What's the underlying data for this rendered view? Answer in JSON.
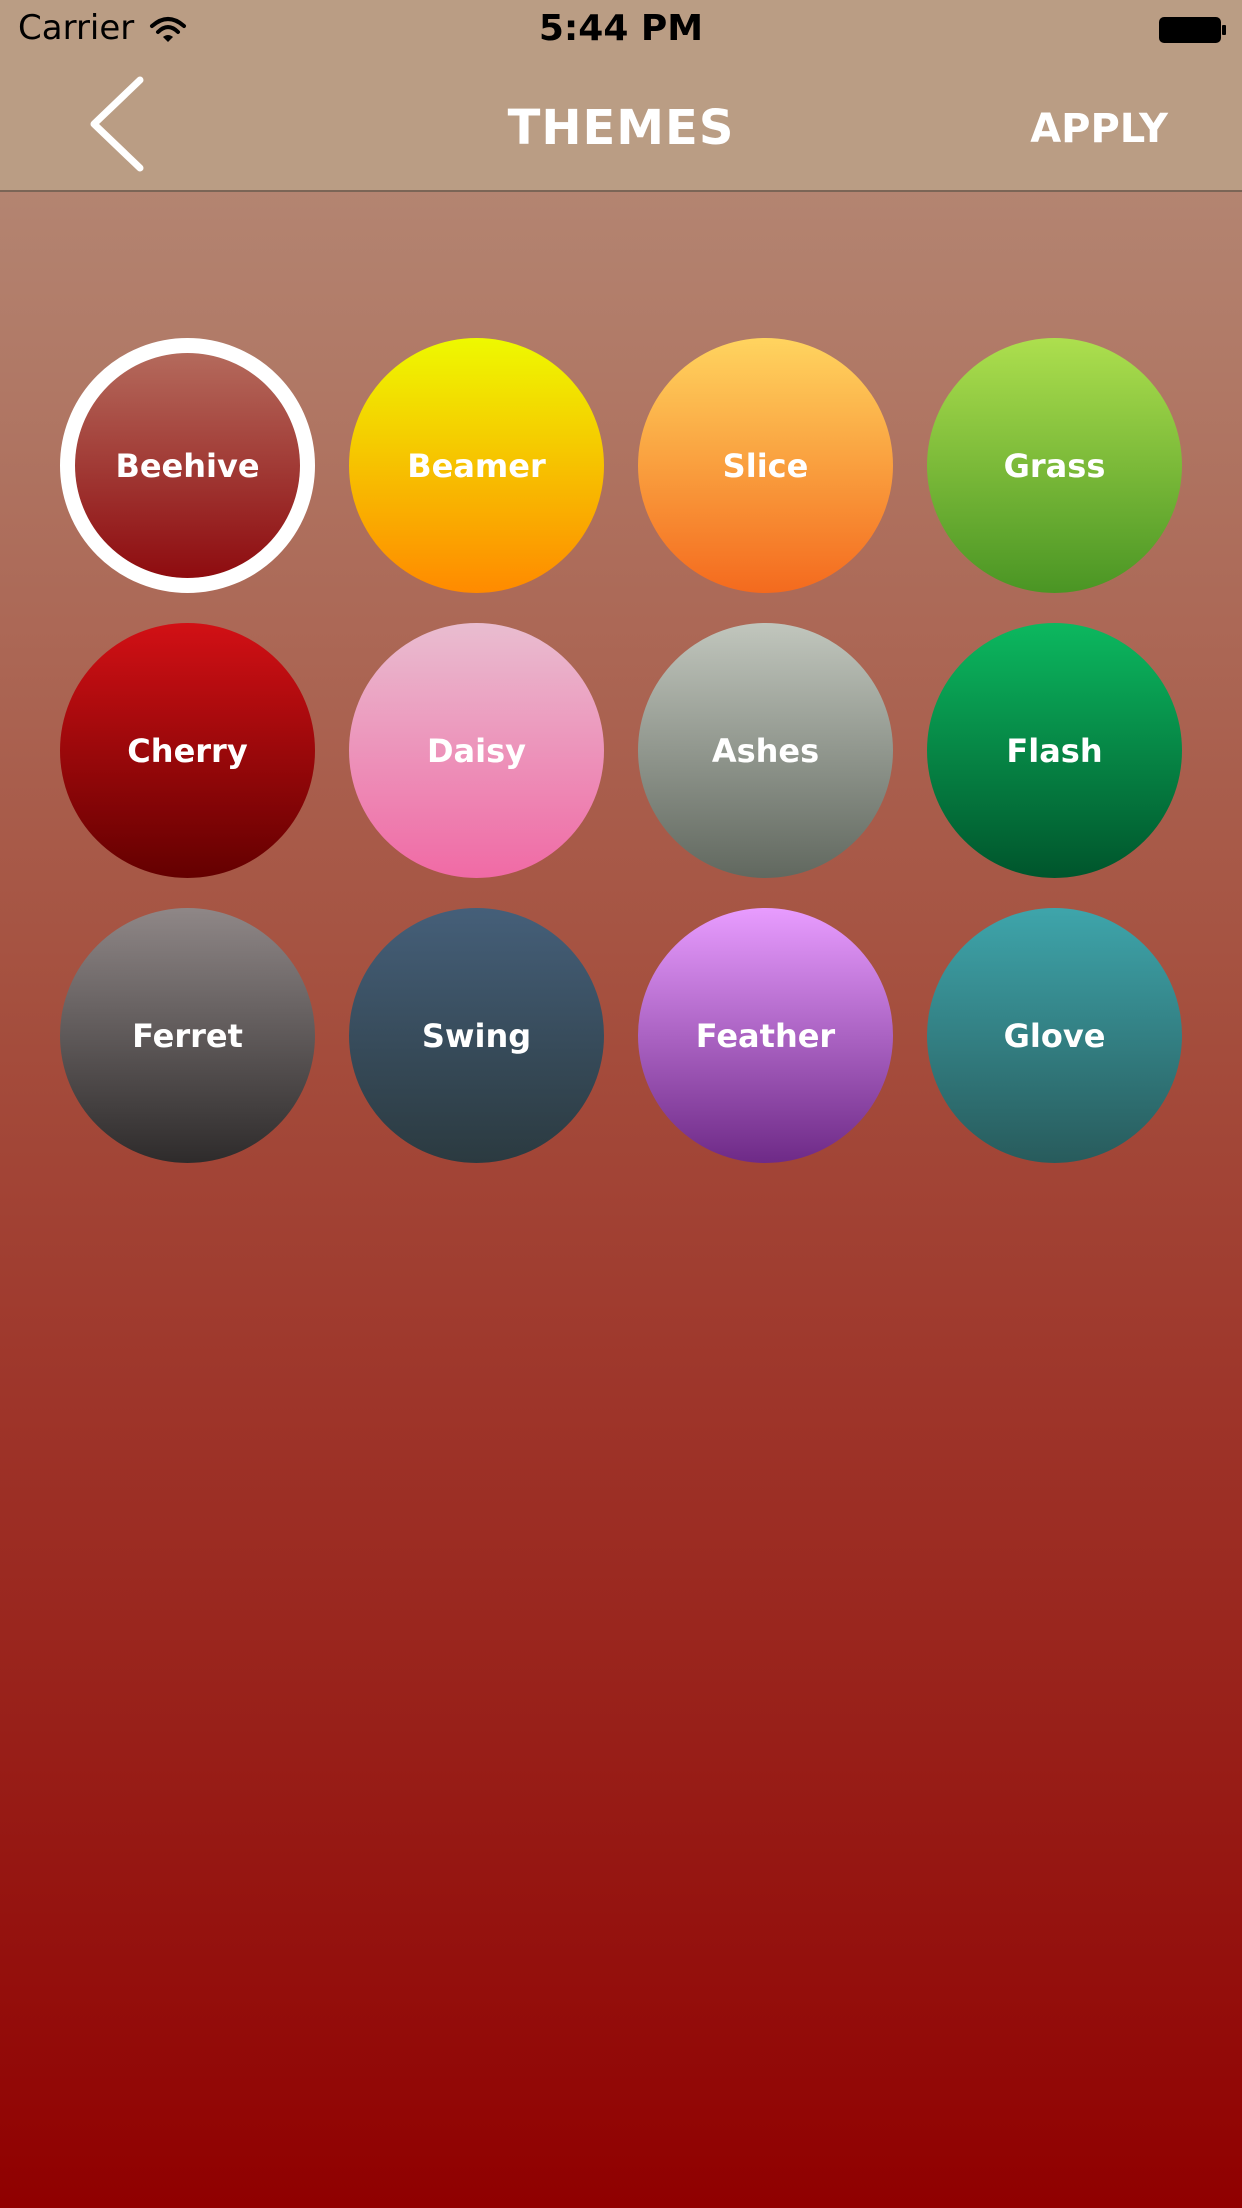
{
  "status_bar": {
    "carrier": "Carrier",
    "time": "5:44 PM",
    "icons": [
      "wifi-icon",
      "battery-icon"
    ]
  },
  "nav": {
    "back_icon": "chevron-left-icon",
    "title": "THEMES",
    "apply_label": "APPLY"
  },
  "themes": [
    {
      "name": "Beehive",
      "selected": true,
      "colors": [
        "#b46a5c",
        "#8e0b0f"
      ]
    },
    {
      "name": "Beamer",
      "selected": false,
      "colors": [
        "#eef900",
        "#ff8a00"
      ]
    },
    {
      "name": "Slice",
      "selected": false,
      "colors": [
        "#ffd45f",
        "#f46a1e"
      ]
    },
    {
      "name": "Grass",
      "selected": false,
      "colors": [
        "#addf4e",
        "#4a9524"
      ]
    },
    {
      "name": "Cherry",
      "selected": false,
      "colors": [
        "#d21015",
        "#640000"
      ]
    },
    {
      "name": "Daisy",
      "selected": false,
      "colors": [
        "#e9bdd0",
        "#f06aa5"
      ]
    },
    {
      "name": "Ashes",
      "selected": false,
      "colors": [
        "#c1c6bd",
        "#61685f"
      ]
    },
    {
      "name": "Flash",
      "selected": false,
      "colors": [
        "#0cb85f",
        "#00552c"
      ]
    },
    {
      "name": "Ferret",
      "selected": false,
      "colors": [
        "#8f8787",
        "#2e2b2b"
      ]
    },
    {
      "name": "Swing",
      "selected": false,
      "colors": [
        "#455f79",
        "#2b3a40"
      ]
    },
    {
      "name": "Feather",
      "selected": false,
      "colors": [
        "#e89cff",
        "#6e2a87"
      ]
    },
    {
      "name": "Glove",
      "selected": false,
      "colors": [
        "#3ea5ab",
        "#285b5c"
      ]
    }
  ]
}
